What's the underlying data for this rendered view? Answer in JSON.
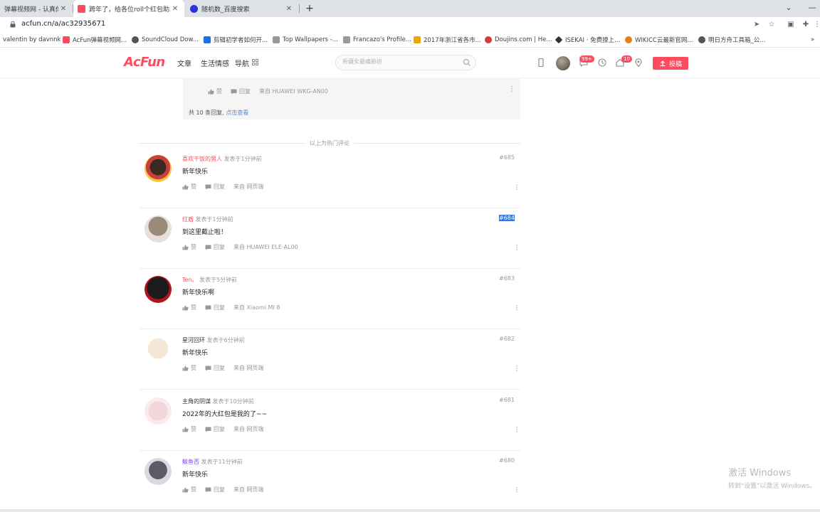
{
  "browser": {
    "tabs": [
      {
        "title": "弹幕视频网 - 认真你就输",
        "favicon_color": "#888888",
        "active": false
      },
      {
        "title": "跨年了，给各位roll个红包助助兴",
        "favicon_color": "#fd4c5d",
        "active": true
      },
      {
        "title": "随机数_百度搜索",
        "favicon_color": "#2932e1",
        "active": false
      }
    ],
    "new_tab_label": "+",
    "url": "acfun.cn/a/ac32935671",
    "bookmarks": [
      {
        "label": "valentin by davnnk",
        "color": ""
      },
      {
        "label": "AcFun弹幕视频网...",
        "color": "#fd4c5d"
      },
      {
        "label": "SoundCloud Dow...",
        "color": "#555555"
      },
      {
        "label": "剪辑初学者如何开...",
        "color": "#1f6feb"
      },
      {
        "label": "Top Wallpapers -...",
        "color": "#888888"
      },
      {
        "label": "Francazo's Profile...",
        "color": "#888888"
      },
      {
        "label": "2017年浙江省各市...",
        "color": "#f0a500"
      },
      {
        "label": "Doujins.com | He...",
        "color": "#d33a3a"
      },
      {
        "label": "ISEKAI · 免费撩上...",
        "color": "#333333"
      },
      {
        "label": "WIKICC云最新官网...",
        "color": "#e2811b"
      },
      {
        "label": "明日方舟工具箱_公...",
        "color": "#555555"
      }
    ],
    "bookmarks_more": "»"
  },
  "site": {
    "logo": "AcFun",
    "nav": [
      "文章",
      "生活情感",
      "导航"
    ],
    "search_placeholder": "新疆女最痛胁迫",
    "badges": {
      "messages": "99+",
      "dynamic": "10"
    },
    "upload_label": "投稿"
  },
  "top_reply": {
    "like": "赞",
    "reply": "回复",
    "source": "来自 HUAWEI  WKG-AN00",
    "total_prefix": "共  10  条回复,",
    "total_link": "点击查看"
  },
  "divider_label": "以上为热门评论",
  "comments": [
    {
      "name": "喜欢干饭的男人",
      "name_color": "#fd4c5d",
      "time": "发表于1分钟前",
      "floor": "#685",
      "text": "新年快乐",
      "like": "赞",
      "reply": "回复",
      "source": "来自 网页端",
      "selected": false
    },
    {
      "name": "红盾",
      "name_color": "#fd4c5d",
      "time": "发表于1分钟前",
      "floor": "#684",
      "text": "到这里截止啦！",
      "like": "赞",
      "reply": "回复",
      "source": "来自 HUAWEI  ELE-AL00",
      "selected": true
    },
    {
      "name": "Ten。",
      "name_color": "#fd4c5d",
      "time": "发表于5分钟前",
      "floor": "#683",
      "text": "新年快乐啊",
      "like": "赞",
      "reply": "回复",
      "source": "来自 Xiaomi  MI  8",
      "selected": false
    },
    {
      "name": "星河回环",
      "name_color": "#333333",
      "time": "发表于6分钟前",
      "floor": "#682",
      "text": "新年快乐",
      "like": "赞",
      "reply": "回复",
      "source": "来自 网页端",
      "selected": false
    },
    {
      "name": "主角的阴谋",
      "name_color": "#333333",
      "time": "发表于10分钟前",
      "floor": "#681",
      "text": "2022年的大红包是我的了~~",
      "like": "赞",
      "reply": "回复",
      "source": "来自 网页端",
      "selected": false
    },
    {
      "name": "鲸鱼否",
      "name_color": "#7a3cff",
      "time": "发表于11分钟前",
      "floor": "#680",
      "text": "新年快乐",
      "like": "赞",
      "reply": "回复",
      "source": "来自 网页端",
      "selected": false
    }
  ],
  "windows_watermark": {
    "line1": "激活 Windows",
    "line2": "转到\"设置\"以激活 Windows。"
  }
}
